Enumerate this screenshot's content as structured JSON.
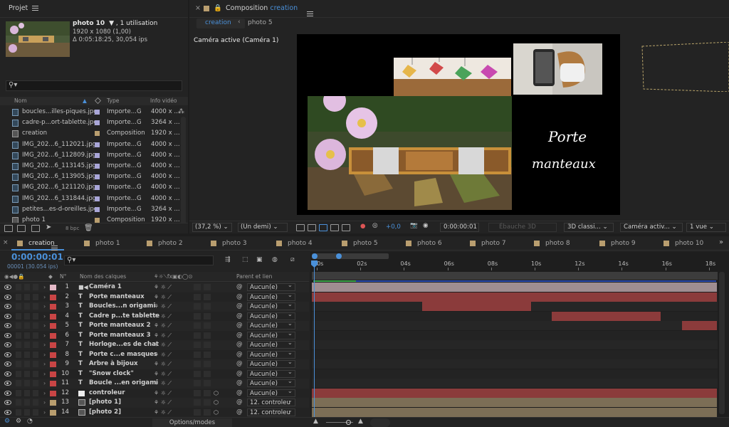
{
  "project": {
    "tab_label": "Projet",
    "item_name": "photo 10",
    "usage": ", 1 utilisation",
    "dims": "1920 x 1080 (1,00)",
    "duration": "Δ 0:05:18:25, 30,054 ips",
    "search_placeholder": "",
    "col_name": "Nom",
    "col_type": "Type",
    "col_info": "Info vidéo",
    "bpc": "8 bpc",
    "items": [
      {
        "name": "boucles...illes-piques.jpg",
        "type": "Importe...G",
        "info": "4000 x ...",
        "label": "#a9a6d8"
      },
      {
        "name": "cadre-p...ort-tablette.jpg",
        "type": "Importe...G",
        "info": "3264 x ...",
        "label": "#a9a6d8"
      },
      {
        "name": "creation",
        "type": "Composition",
        "info": "1920 x ...",
        "label": "#b99e6f"
      },
      {
        "name": "IMG_202...6_112021.jpg",
        "type": "Importe...G",
        "info": "4000 x ...",
        "label": "#a9a6d8"
      },
      {
        "name": "IMG_202...6_112809.jpg",
        "type": "Importe...G",
        "info": "4000 x ...",
        "label": "#a9a6d8"
      },
      {
        "name": "IMG_202...6_113145.jpg",
        "type": "Importe...G",
        "info": "4000 x ...",
        "label": "#a9a6d8"
      },
      {
        "name": "IMG_202...6_113905.jpg",
        "type": "Importe...G",
        "info": "4000 x ...",
        "label": "#a9a6d8"
      },
      {
        "name": "IMG_202...6_121120.jpg",
        "type": "Importe...G",
        "info": "4000 x ...",
        "label": "#a9a6d8"
      },
      {
        "name": "IMG_202...6_131844.jpg",
        "type": "Importe...G",
        "info": "4000 x ...",
        "label": "#a9a6d8"
      },
      {
        "name": "petites...es-d-oreilles.jpg",
        "type": "Importe...G",
        "info": "3264 x ...",
        "label": "#a9a6d8"
      },
      {
        "name": "photo 1",
        "type": "Composition",
        "info": "1920 x ...",
        "label": "#b99e6f"
      }
    ]
  },
  "composition": {
    "close": "×",
    "title_prefix": "Composition",
    "title_name": "creation",
    "tabs": [
      "creation",
      "photo 5"
    ],
    "active_camera": "Caméra active (Caméra 1)",
    "overlay_text_1": "Porte",
    "overlay_text_2": "manteaux",
    "zoom": "(37,2 %)",
    "resolution": "(Un demi)",
    "exposure": "+0,0",
    "timecode": "0:00:00:01",
    "draft3d": "Ébauche 3D",
    "renderer": "3D classi...",
    "camera": "Caméra activ...",
    "views": "1 vue"
  },
  "timeline": {
    "comp_tabs": [
      "creation",
      "photo 1",
      "photo 2",
      "photo 3",
      "photo 4",
      "photo 5",
      "photo 6",
      "photo 7",
      "photo 8",
      "photo 9",
      "photo 10"
    ],
    "current_time": "0:00:00:01",
    "frame_info": "00001 (30.054 ips)",
    "col_num": "N°",
    "col_name": "Nom des calques",
    "col_parent": "Parent et lien",
    "ruler": [
      "00s",
      "02s",
      "04s",
      "06s",
      "08s",
      "10s",
      "12s",
      "14s",
      "16s",
      "18s"
    ],
    "options_label": "Options/modes",
    "layers": [
      {
        "num": "1",
        "type": "cam",
        "name": "Caméra 1",
        "color": "#e4b9c7",
        "parent": "Aucun(e)",
        "bar": [
          0,
          100
        ],
        "bar_color": "#9f8d91"
      },
      {
        "num": "2",
        "type": "T",
        "name": "Porte manteaux",
        "color": "#c94545",
        "parent": "Aucun(e)",
        "bar": [
          0,
          100
        ],
        "bar_color": "#8b3b3b"
      },
      {
        "num": "3",
        "type": "T",
        "name": "Boucles...n origami",
        "color": "#c94545",
        "parent": "Aucun(e)",
        "bar": [
          27.2,
          54.2
        ],
        "bar_color": "#8b3b3b"
      },
      {
        "num": "4",
        "type": "T",
        "name": "Cadre p...te tablette",
        "color": "#c94545",
        "parent": "Aucun(e)",
        "bar": [
          59.1,
          86.1
        ],
        "bar_color": "#8b3b3b"
      },
      {
        "num": "5",
        "type": "T",
        "name": "Porte manteaux 2",
        "color": "#c94545",
        "parent": "Aucun(e)",
        "bar": [
          91.3,
          100
        ],
        "bar_color": "#8b3b3b"
      },
      {
        "num": "6",
        "type": "T",
        "name": "Porte manteaux 3",
        "color": "#c94545",
        "parent": "Aucun(e)",
        "bar": [
          0,
          0
        ],
        "bar_color": "#8b3b3b"
      },
      {
        "num": "7",
        "type": "T",
        "name": "Horloge...es de chat",
        "color": "#c94545",
        "parent": "Aucun(e)",
        "bar": [
          0,
          0
        ],
        "bar_color": "#8b3b3b"
      },
      {
        "num": "8",
        "type": "T",
        "name": "Porte c...e masques",
        "color": "#c94545",
        "parent": "Aucun(e)",
        "bar": [
          0,
          0
        ],
        "bar_color": "#8b3b3b"
      },
      {
        "num": "9",
        "type": "T",
        "name": "Arbre  à bijoux",
        "color": "#c94545",
        "parent": "Aucun(e)",
        "bar": [
          0,
          0
        ],
        "bar_color": "#8b3b3b"
      },
      {
        "num": "10",
        "type": "T",
        "name": "\"Snow clock\"",
        "color": "#c94545",
        "parent": "Aucun(e)",
        "bar": [
          0,
          0
        ],
        "bar_color": "#8b3b3b"
      },
      {
        "num": "11",
        "type": "T",
        "name": "Boucle ...en origami",
        "color": "#c94545",
        "parent": "Aucun(e)",
        "bar": [
          0,
          0
        ],
        "bar_color": "#8b3b3b"
      },
      {
        "num": "12",
        "type": "solid",
        "name": "controleur",
        "color": "#c94545",
        "parent": "Aucun(e)",
        "bar": [
          0,
          100
        ],
        "bar_color": "#8b3b3b"
      },
      {
        "num": "13",
        "type": "img",
        "name": "[photo 1]",
        "color": "#b99e6f",
        "parent": "12. controleu",
        "bar": [
          0,
          100
        ],
        "bar_color": "#7c6e56"
      },
      {
        "num": "14",
        "type": "img",
        "name": "[photo 2]",
        "color": "#b99e6f",
        "parent": "12. controleu",
        "bar": [
          0,
          100
        ],
        "bar_color": "#7c6e56"
      }
    ]
  }
}
